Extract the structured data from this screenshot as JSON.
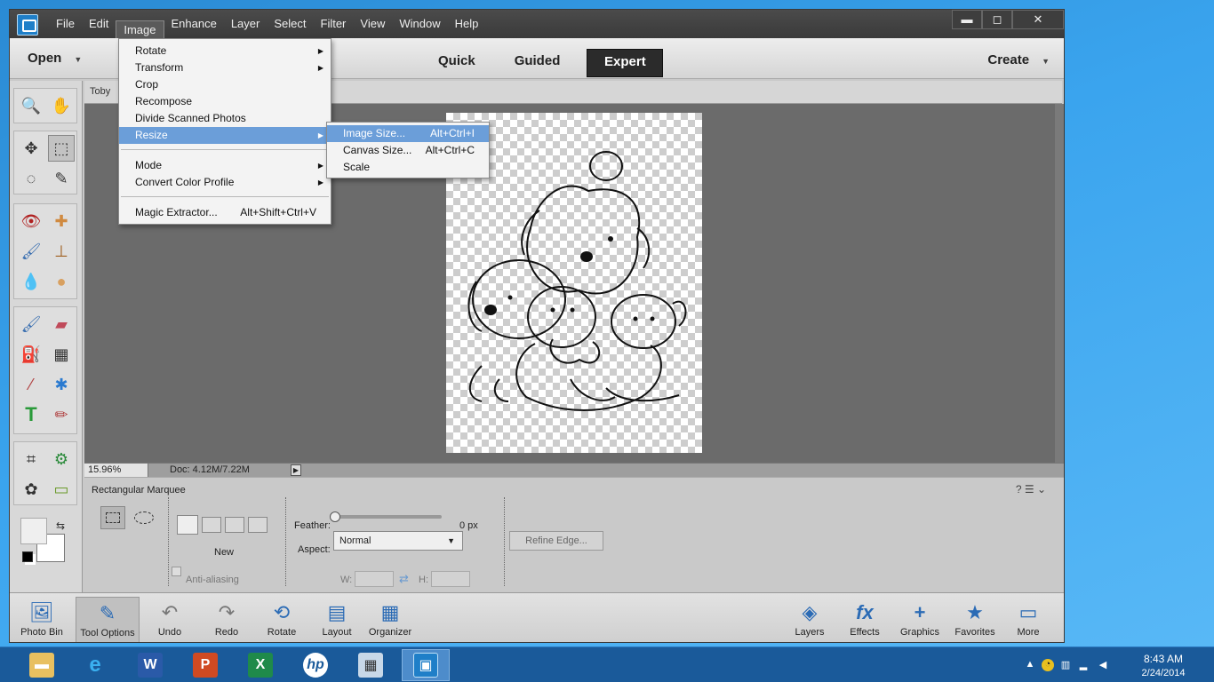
{
  "menubar": {
    "items": [
      "File",
      "Edit",
      "Image",
      "Enhance",
      "Layer",
      "Select",
      "Filter",
      "View",
      "Window",
      "Help"
    ],
    "active": "Image"
  },
  "window_controls": {
    "minimize": "▬",
    "maximize": "◻",
    "close": "✕"
  },
  "modebar": {
    "open_label": "Open",
    "tabs": [
      "Quick",
      "Guided",
      "Expert"
    ],
    "selected_tab": "Expert",
    "create_label": "Create"
  },
  "document": {
    "tab_label": "Toby",
    "zoom": "15.96%",
    "doc_size": "Doc: 4.12M/7.22M"
  },
  "image_menu": {
    "items": [
      {
        "label": "Rotate",
        "submenu": true
      },
      {
        "label": "Transform",
        "submenu": true
      },
      {
        "label": "Crop"
      },
      {
        "label": "Recompose"
      },
      {
        "label": "Divide Scanned Photos"
      },
      {
        "label": "Resize",
        "submenu": true,
        "highlighted": true
      },
      {
        "label": "Mode",
        "submenu": true
      },
      {
        "label": "Convert Color Profile",
        "submenu": true
      },
      {
        "label": "Magic Extractor...",
        "shortcut": "Alt+Shift+Ctrl+V"
      }
    ]
  },
  "resize_submenu": {
    "items": [
      {
        "label": "Image Size...",
        "shortcut": "Alt+Ctrl+I",
        "highlighted": true
      },
      {
        "label": "Canvas Size...",
        "shortcut": "Alt+Ctrl+C"
      },
      {
        "label": "Scale",
        "shortcut": ""
      }
    ]
  },
  "tool_options": {
    "title": "Rectangular Marquee",
    "new_label": "New",
    "anti_aliasing_label": "Anti-aliasing",
    "feather_label": "Feather:",
    "feather_value": "0 px",
    "feather_fraction": 0.0,
    "aspect_label": "Aspect:",
    "aspect_value": "Normal",
    "w_label": "W:",
    "h_label": "H:",
    "refine_edge_label": "Refine Edge..."
  },
  "bottom_bar": {
    "left": [
      {
        "label": "Photo Bin",
        "icon": "photo-bin-icon"
      },
      {
        "label": "Tool Options",
        "icon": "tool-options-icon",
        "selected": true
      },
      {
        "label": "Undo",
        "icon": "undo-icon"
      },
      {
        "label": "Redo",
        "icon": "redo-icon"
      },
      {
        "label": "Rotate",
        "icon": "rotate-icon"
      },
      {
        "label": "Layout",
        "icon": "layout-icon"
      },
      {
        "label": "Organizer",
        "icon": "organizer-icon"
      }
    ],
    "right": [
      {
        "label": "Layers",
        "icon": "layers-icon"
      },
      {
        "label": "Effects",
        "icon": "effects-icon"
      },
      {
        "label": "Graphics",
        "icon": "graphics-icon"
      },
      {
        "label": "Favorites",
        "icon": "favorites-icon"
      },
      {
        "label": "More",
        "icon": "more-icon"
      }
    ]
  },
  "tools": [
    "zoom-tool-icon",
    "hand-tool-icon",
    "move-tool-icon",
    "rectangular-marquee-icon",
    "lasso-tool-icon",
    "quick-selection-icon",
    "red-eye-icon",
    "spot-healing-icon",
    "smart-brush-icon",
    "clone-stamp-icon",
    "blur-tool-icon",
    "sponge-tool-icon",
    "brush-tool-icon",
    "eraser-tool-icon",
    "paint-bucket-icon",
    "gradient-tool-icon",
    "eyedropper-icon",
    "custom-shape-icon",
    "type-tool-icon",
    "pencil-tool-icon",
    "crop-tool-icon",
    "recompose-tool-icon",
    "cookie-cutter-icon",
    "straighten-tool-icon"
  ],
  "taskbar": {
    "apps": [
      "file-explorer-icon",
      "internet-explorer-icon",
      "word-icon",
      "powerpoint-icon",
      "excel-icon",
      "hp-icon",
      "calculator-icon",
      "photoshop-elements-icon"
    ],
    "time": "8:43 AM",
    "date": "2/24/2014"
  },
  "colors": {
    "accent_highlight": "#6b9ed9",
    "expert_tab": "#2b2b2b",
    "taskbar": "#1a5a9a"
  }
}
